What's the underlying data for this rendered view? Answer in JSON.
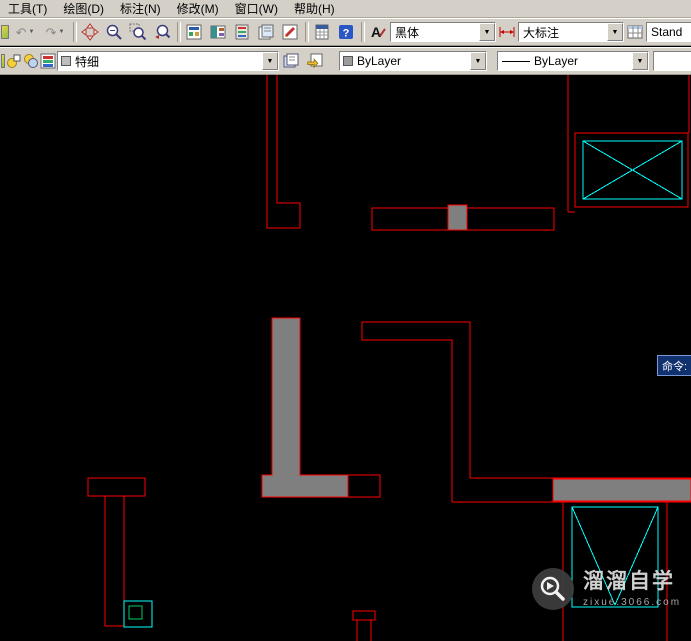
{
  "colors": {
    "toolbar_bg": "#d4d0c8",
    "canvas_bg": "#000000",
    "wall_red": "#ff0000",
    "wall_gray_fill": "#7f7f7f",
    "cad_cyan": "#00ffff",
    "cad_green": "#00cc66",
    "tooltip_bg": "#10306e",
    "tooltip_border": "#7996d9"
  },
  "menu": {
    "items": [
      "工具(T)",
      "绘图(D)",
      "标注(N)",
      "修改(M)",
      "窗口(W)",
      "帮助(H)"
    ]
  },
  "glyphs": {
    "undo": "↶",
    "redo": "↷",
    "caret": "▼",
    "help": "?",
    "text_style": "A"
  },
  "toolbar_standard": {
    "font_style_value": "黑体",
    "dim_style_value": "大标注",
    "table_style_value": "Stand"
  },
  "toolbar_layers": {
    "layer_value": "特细",
    "color_value": "ByLayer",
    "linetype_value": "ByLayer"
  },
  "canvas": {
    "command_tooltip": "命令:"
  },
  "watermark": {
    "title": "溜溜自学",
    "subtitle": "zixue.3066.com"
  }
}
